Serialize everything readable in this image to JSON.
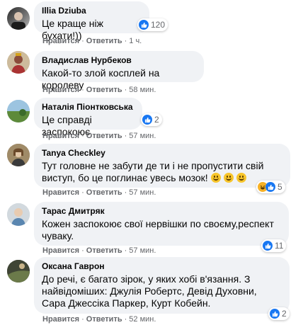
{
  "labels": {
    "like": "Нравится",
    "reply": "Ответить",
    "dot": "·"
  },
  "comments": [
    {
      "author": "Illia Dziuba",
      "text": "Це краще ніж бухати!))",
      "reactions": "120",
      "time": "1 ч."
    },
    {
      "author": "Владислав Нурбеков",
      "text": "Какой-то злой косплей на королеву",
      "reactions": "",
      "time": "58 мин."
    },
    {
      "author": "Наталія Піонтковська",
      "text": "Це справді заспокоює",
      "reactions": "2",
      "time": "57 мин."
    },
    {
      "author": "Tanya Checkley",
      "text": "Тут головне не забути де ти і не пропустити свій виступ, бо це поглинає увесь мозок!",
      "reactions": "5",
      "time": "57 мин."
    },
    {
      "author": "Тарас Дмитряк",
      "text": "Кожен заспокоює свої нервішки по своєму,респект чуваку.",
      "reactions": "11",
      "time": "57 мин."
    },
    {
      "author": "Оксана Гаврон",
      "text": "До речі, є багато зірок, у яких хобі в'язання. З найвідоміших: Джулія Робертс, Девід Духовни, Сара Джессіка Паркер, Курт Кобейн.",
      "reactions": "2",
      "time": "52 мин."
    }
  ],
  "colors": {
    "bubble": "#f0f2f5",
    "like": "#1877f2",
    "haha": "#f7b125",
    "meta": "#65676b"
  }
}
